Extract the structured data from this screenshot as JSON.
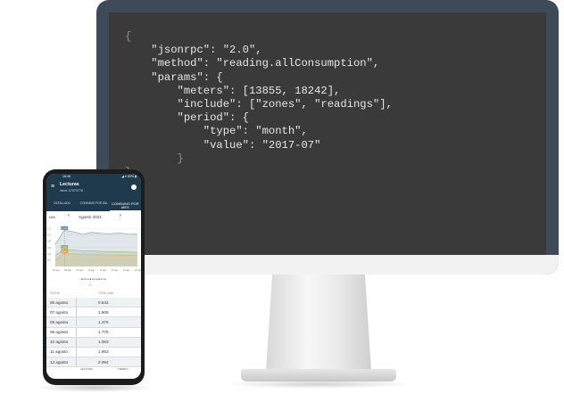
{
  "code": {
    "lines": [
      {
        "text": "{",
        "dim": true
      },
      {
        "text": "    \"jsonrpc\": \"2.0\",",
        "dim": false
      },
      {
        "text": "    \"method\": \"reading.allConsumption\",",
        "dim": false
      },
      {
        "text": "    \"params\": {",
        "dim": false
      },
      {
        "text": "        \"meters\": [13855, 18242],",
        "dim": false
      },
      {
        "text": "        \"include\": [\"zones\", \"readings\"],",
        "dim": false
      },
      {
        "text": "        \"period\": {",
        "dim": false
      },
      {
        "text": "            \"type\": \"month\",",
        "dim": false
      },
      {
        "text": "            \"value\": \"2017-07\"",
        "dim": false
      },
      {
        "text": "        }",
        "dim": true
      },
      {
        "text": "}",
        "dim": true
      }
    ]
  },
  "phone": {
    "status_time": "16:45",
    "status_icons": "◢ ▾ 83% ▮",
    "menu_icon": "≡",
    "title": "Lecturas",
    "subtitle": "Ident: 67579778",
    "tabs": [
      {
        "label": "DETALLADO",
        "active": false
      },
      {
        "label": "CONSUMO POR DÍA",
        "active": false
      },
      {
        "label": "CONSUMO POR MES",
        "active": true
      }
    ],
    "unit": "kWh",
    "month": "Agosto 2021",
    "prev_icon": "‹",
    "next_icon": "›",
    "legend": "■ Zona  ■ Zona  ■ Zona",
    "collapse_icon": "︿",
    "table_headers": {
      "date": "FECHA",
      "value": "TOTAL kWh"
    },
    "rows": [
      {
        "date": "06 agosto",
        "value": "0.542"
      },
      {
        "date": "07 agosto",
        "value": "1.906"
      },
      {
        "date": "08 agosto",
        "value": "1.376"
      },
      {
        "date": "09 agosto",
        "value": "1.775"
      },
      {
        "date": "10 agosto",
        "value": "1.063"
      },
      {
        "date": "11 agosto",
        "value": "1.953"
      },
      {
        "date": "12 agosto",
        "value": "2.054"
      }
    ],
    "footer": {
      "col1": "LECTURA",
      "col2": "TIEMPO"
    }
  },
  "chart_data": {
    "type": "area",
    "y_ticks": [
      "1.2",
      "1.0",
      "0.8",
      "0.6",
      "0.4",
      "0.2"
    ],
    "x_ticks": [
      "06 ago",
      "08 ago",
      "10 ago",
      "12 ago",
      "14 ago",
      "16 ago",
      "18 ago",
      "20 ago"
    ],
    "series": [
      {
        "color": "#8fa6b5",
        "values": [
          0.7,
          1.15,
          1.1,
          1.02,
          1.08,
          1.05,
          1.04,
          1.06,
          1.03,
          1.02
        ]
      },
      {
        "color": "#9bbf92",
        "values": [
          0.35,
          0.55,
          0.52,
          0.5,
          0.49,
          0.48,
          0.47,
          0.47,
          0.46,
          0.45
        ]
      },
      {
        "color": "#e3b07a",
        "values": [
          0.2,
          0.42,
          0.4,
          0.38,
          0.37,
          0.37,
          0.36,
          0.36,
          0.35,
          0.35
        ]
      }
    ],
    "annotations": [
      "1.14",
      "0.58",
      "0.41"
    ],
    "ylim": [
      0,
      1.3
    ]
  }
}
